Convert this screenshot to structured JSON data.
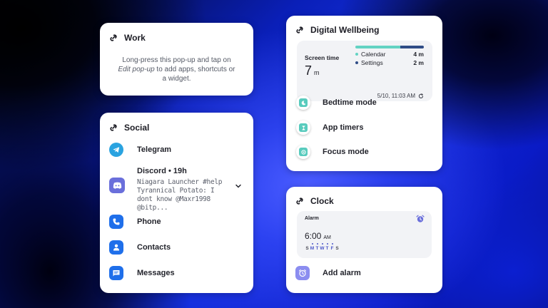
{
  "work": {
    "title": "Work",
    "hint_line1": "Long-press this pop-up and tap on",
    "hint_em": "Edit pop-up",
    "hint_line2_rest": " to add apps, shortcuts or",
    "hint_line3": "a widget."
  },
  "social": {
    "title": "Social",
    "apps": [
      {
        "label": "Telegram",
        "icon": "telegram-icon",
        "color": "#2AA3E0"
      },
      {
        "label": "Phone",
        "icon": "phone-icon",
        "color": "#1F6FEA"
      },
      {
        "label": "Contacts",
        "icon": "contacts-icon",
        "color": "#1F6FEA"
      },
      {
        "label": "Messages",
        "icon": "messages-icon",
        "color": "#1F6FEA"
      }
    ],
    "discord": {
      "title": "Discord • 19h",
      "message": "Niagara Launcher #help Tyrannical Potato: I dont know @Maxr1998 @bitp...",
      "icon": "discord-icon",
      "color": "#6A6FDB"
    }
  },
  "wellbeing": {
    "title": "Digital Wellbeing",
    "screen_time_label": "Screen time",
    "screen_time_value": "7",
    "screen_time_unit": "m",
    "apps": [
      {
        "name": "Calendar",
        "value": "4 m",
        "color": "#63D3C3"
      },
      {
        "name": "Settings",
        "value": "2 m",
        "color": "#2F4C86"
      }
    ],
    "updated": "5/10, 11:03 AM",
    "actions": [
      {
        "label": "Bedtime mode",
        "icon": "moon-icon"
      },
      {
        "label": "App timers",
        "icon": "hourglass-icon"
      },
      {
        "label": "Focus mode",
        "icon": "focus-icon"
      }
    ],
    "accent": "#58CBBD"
  },
  "clock": {
    "title": "Clock",
    "alarm_label": "Alarm",
    "alarm_time": "6:00",
    "alarm_ampm": "AM",
    "days": [
      {
        "d": "S",
        "on": false
      },
      {
        "d": "M",
        "on": true
      },
      {
        "d": "T",
        "on": true
      },
      {
        "d": "W",
        "on": true
      },
      {
        "d": "T",
        "on": true
      },
      {
        "d": "F",
        "on": true
      },
      {
        "d": "S",
        "on": false
      }
    ],
    "add_alarm_label": "Add alarm",
    "accent": "#8B8DF0"
  }
}
